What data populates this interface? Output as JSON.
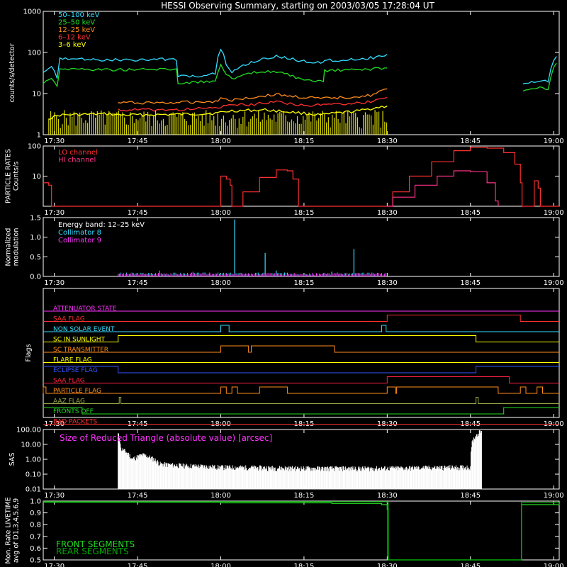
{
  "title": "HESSI Observing Summary, starting on 2003/03/05 17:28:04 UT",
  "time_axis": {
    "ticks": [
      "17:30",
      "17:45",
      "18:00",
      "18:15",
      "18:30",
      "18:45",
      "19:00"
    ],
    "range_minutes": [
      118,
      211
    ],
    "tick_minutes": [
      120,
      135,
      150,
      165,
      180,
      195,
      210
    ]
  },
  "colors": {
    "white": "#ffffff",
    "red": "#ff3030",
    "orange": "#ff8c1a",
    "yellow": "#ffff00",
    "green": "#22dd22",
    "cyan": "#33ddff",
    "magenta": "#ff33ff",
    "blue": "#3355ff",
    "olive": "#99aa44",
    "darkgreen": "#00aa00",
    "crimson": "#ff2244"
  },
  "chart_data": [
    {
      "id": "count-rates",
      "type": "line",
      "ylabel": "counts/s/detector",
      "yscale": "log",
      "ylim": [
        1,
        1000
      ],
      "yticks": [
        "1",
        "10",
        "100",
        "1000"
      ],
      "ytick_values": [
        1,
        10,
        100,
        1000
      ],
      "legend_placement": "top-left",
      "series": [
        {
          "name": "50–100 keV",
          "color": "#33ddff",
          "points": [
            [
              118,
              30
            ],
            [
              119.5,
              45
            ],
            [
              120.5,
              25
            ],
            [
              121,
              70
            ],
            [
              130,
              66
            ],
            [
              142,
              68
            ],
            [
              142.3,
              26
            ],
            [
              146,
              27
            ],
            [
              149,
              30
            ],
            [
              150,
              120
            ],
            [
              151,
              50
            ],
            [
              152,
              32
            ],
            [
              155,
              55
            ],
            [
              160,
              80
            ],
            [
              165,
              60
            ],
            [
              168.5,
              58
            ],
            [
              168.7,
              64
            ],
            [
              173,
              66
            ],
            [
              178,
              75
            ],
            [
              180,
              90
            ]
          ]
        },
        {
          "name": "25–50 keV",
          "color": "#22dd22",
          "points": [
            [
              118,
              18
            ],
            [
              119.5,
              25
            ],
            [
              120.5,
              15
            ],
            [
              121,
              40
            ],
            [
              130,
              38
            ],
            [
              142,
              39
            ],
            [
              142.3,
              18
            ],
            [
              149,
              20
            ],
            [
              150,
              50
            ],
            [
              151,
              30
            ],
            [
              152,
              22
            ],
            [
              156,
              32
            ],
            [
              160,
              35
            ],
            [
              163,
              26
            ],
            [
              165,
              20
            ],
            [
              168.5,
              20
            ],
            [
              168.7,
              36
            ],
            [
              175,
              38
            ],
            [
              180,
              42
            ]
          ]
        },
        {
          "name": "12–25 keV",
          "color": "#ff8c1a",
          "points": [
            [
              131.5,
              6
            ],
            [
              142,
              6
            ],
            [
              149,
              6.5
            ],
            [
              150,
              7.5
            ],
            [
              152,
              7
            ],
            [
              157,
              8.5
            ],
            [
              160,
              9.5
            ],
            [
              163,
              8.5
            ],
            [
              168,
              7.5
            ],
            [
              172,
              8
            ],
            [
              177,
              9
            ],
            [
              180,
              13
            ]
          ]
        },
        {
          "name": "6–12 keV",
          "color": "#ff3030",
          "points": [
            [
              131.5,
              4
            ],
            [
              142,
              4
            ],
            [
              149,
              4.5
            ],
            [
              151,
              5
            ],
            [
              156,
              5.5
            ],
            [
              160,
              6.5
            ],
            [
              165,
              5
            ],
            [
              170,
              5.5
            ],
            [
              176,
              6
            ],
            [
              180,
              8
            ]
          ]
        },
        {
          "name": "3–6 keV",
          "color": "#ffff00",
          "points": [
            [
              119,
              2.5
            ],
            [
              121,
              3
            ],
            [
              130,
              3.2
            ],
            [
              131.5,
              3
            ],
            [
              142,
              3.1
            ],
            [
              149,
              3.3
            ],
            [
              152,
              3.8
            ],
            [
              158,
              4
            ],
            [
              163,
              3.5
            ],
            [
              168,
              3
            ],
            [
              175,
              3.8
            ],
            [
              180,
              5
            ]
          ]
        }
      ],
      "late_segments": [
        {
          "color": "#33ddff",
          "points": [
            [
              204.5,
              18
            ],
            [
              207,
              20
            ],
            [
              209,
              20
            ],
            [
              210.5,
              80
            ]
          ]
        },
        {
          "color": "#22dd22",
          "points": [
            [
              204.5,
              12
            ],
            [
              207,
              14
            ],
            [
              209,
              13
            ],
            [
              210.5,
              55
            ]
          ]
        }
      ]
    },
    {
      "id": "particle-rates",
      "type": "line",
      "ylabel": "PARTICLE RATES Counts/s",
      "yscale": "log",
      "ylim": [
        1,
        100
      ],
      "yticks": [
        "10",
        "100"
      ],
      "ytick_values": [
        10,
        100
      ],
      "legend_placement": "top-left",
      "series": [
        {
          "name": "LO channel",
          "color": "#ff3030",
          "points": [
            [
              118,
              6
            ],
            [
              119,
              5
            ],
            [
              119.5,
              1
            ],
            [
              149.5,
              1
            ],
            [
              150,
              10
            ],
            [
              151,
              8
            ],
            [
              151.7,
              5
            ],
            [
              152,
              1
            ],
            [
              153,
              1
            ],
            [
              154,
              3
            ],
            [
              157,
              9
            ],
            [
              160,
              16
            ],
            [
              162,
              15
            ],
            [
              163,
              8
            ],
            [
              164,
              1
            ],
            [
              180,
              1
            ],
            [
              181,
              3
            ],
            [
              184,
              10
            ],
            [
              188,
              30
            ],
            [
              192,
              70
            ],
            [
              195,
              90
            ],
            [
              198,
              85
            ],
            [
              201,
              60
            ],
            [
              203,
              25
            ],
            [
              204,
              6
            ],
            [
              204.3,
              1
            ],
            [
              206,
              1
            ],
            [
              206.5,
              7
            ],
            [
              207.2,
              4
            ],
            [
              207.6,
              1
            ],
            [
              211,
              1
            ]
          ]
        },
        {
          "name": "HI channel",
          "color": "#ff3388",
          "points": [
            [
              180,
              1
            ],
            [
              181,
              2
            ],
            [
              185,
              5
            ],
            [
              189,
              10
            ],
            [
              192,
              15
            ],
            [
              195,
              14
            ],
            [
              198,
              6
            ],
            [
              199.5,
              1.5
            ],
            [
              200,
              1
            ]
          ]
        }
      ]
    },
    {
      "id": "modulation",
      "type": "line",
      "ylabel": "Normalized modulation",
      "ylim": [
        0,
        1.5
      ],
      "yticks": [
        "0.0",
        "0.5",
        "1.0",
        "1.5"
      ],
      "ytick_values": [
        0,
        0.5,
        1.0,
        1.5
      ],
      "annotations": [
        "Energy band: 12–25 keV"
      ],
      "series": [
        {
          "name": "Collimator 8",
          "color": "#33ddff",
          "baseline": 0.04,
          "range": [
            131.5,
            180
          ],
          "spikes": [
            [
              152.5,
              1.45
            ],
            [
              158,
              0.6
            ],
            [
              160,
              0.15
            ],
            [
              174,
              0.7
            ],
            [
              170,
              0.12
            ]
          ]
        },
        {
          "name": "Collimator 9",
          "color": "#ff33ff",
          "baseline": 0.03,
          "range": [
            131.5,
            180
          ],
          "spikes": [
            [
              139,
              0.15
            ],
            [
              145,
              0.12
            ],
            [
              148,
              0.1
            ]
          ]
        }
      ]
    },
    {
      "id": "flags",
      "type": "line",
      "ylabel": "Flags",
      "rows": [
        {
          "name": "ATTENUATOR STATE",
          "color": "#ff33ff",
          "on": []
        },
        {
          "name": "SAA FLAG",
          "color": "#ff3030",
          "on": [
            [
              180,
              204
            ]
          ]
        },
        {
          "name": "NON SOLAR EVENT",
          "color": "#33ddff",
          "on": [
            [
              150,
              151.5
            ],
            [
              179,
              179.8
            ]
          ]
        },
        {
          "name": "SC IN SUNLIGHT",
          "color": "#ffff00",
          "on": [
            [
              131.5,
              196
            ]
          ]
        },
        {
          "name": "SC TRANSMITTER",
          "color": "#ff8c1a",
          "on": [
            [
              150,
              155
            ],
            [
              155.5,
              170.5
            ]
          ]
        },
        {
          "name": "FLARE FLAG",
          "color": "#ffff00",
          "on": []
        },
        {
          "name": "ECLIPSE FLAG",
          "color": "#3355ff",
          "on_state": "low",
          "on": [
            [
              131.5,
              196
            ]
          ]
        },
        {
          "name": "SAA FLAG",
          "color": "#ff2244",
          "on": [
            [
              180,
              202
            ]
          ]
        },
        {
          "name": "PARTICLE FLAG",
          "color": "#ff8c1a",
          "on": [
            [
              118,
              118.5
            ],
            [
              150,
              151
            ],
            [
              152,
              153
            ],
            [
              157,
              162
            ],
            [
              180,
              181.5
            ],
            [
              181.7,
              200
            ],
            [
              204,
              205
            ],
            [
              207,
              208
            ]
          ]
        },
        {
          "name": "AAZ FLAG",
          "color": "#99aa44",
          "on": [
            [
              131.7,
              132
            ],
            [
              196,
              196.4
            ]
          ]
        },
        {
          "name": "FRONTS OFF",
          "color": "#22dd22",
          "on_state": "low",
          "on": [
            [
              125,
              201
            ]
          ]
        },
        {
          "name": "BAD PACKETS",
          "color": "#ff3030",
          "on": []
        }
      ]
    },
    {
      "id": "sas",
      "type": "area",
      "ylabel": "SAS",
      "yscale": "log",
      "ylim": [
        0.01,
        100
      ],
      "yticks": [
        "0.01",
        "0.10",
        "1.00",
        "10.00",
        "100.00"
      ],
      "ytick_values": [
        0.01,
        0.1,
        1,
        10,
        100
      ],
      "annotations": [
        "Size of Reduced Triangle (absolute value) [arcsec]"
      ],
      "series": [
        {
          "name": "Size of Reduced Triangle",
          "color": "#ffffff",
          "range": [
            131.5,
            197
          ],
          "levels": [
            [
              131.5,
              50
            ],
            [
              132,
              5
            ],
            [
              134,
              1
            ],
            [
              136,
              2
            ],
            [
              138,
              1
            ],
            [
              139,
              0.5
            ],
            [
              142,
              0.4
            ],
            [
              150,
              0.3
            ],
            [
              165,
              0.25
            ],
            [
              180,
              0.25
            ],
            [
              195,
              0.3
            ],
            [
              197,
              80
            ]
          ]
        }
      ]
    },
    {
      "id": "livetime",
      "type": "line",
      "ylabel": "Mon. Rate LIVETIME avg of D1,3,4,5,6,9",
      "ylim": [
        0.5,
        1.0
      ],
      "yticks": [
        "0.5",
        "0.6",
        "0.7",
        "0.8",
        "0.9",
        "1.0"
      ],
      "ytick_values": [
        0.5,
        0.6,
        0.7,
        0.8,
        0.9,
        1.0
      ],
      "legend_placement": "bottom-left",
      "series": [
        {
          "name": "FRONT SEGMENTS",
          "color": "#22dd22",
          "points": [
            [
              118,
              0.99
            ],
            [
              150,
              0.985
            ],
            [
              170,
              0.98
            ],
            [
              179,
              0.97
            ],
            [
              180,
              0.93
            ],
            [
              180.1,
              0.5
            ],
            [
              204,
              0.5
            ],
            [
              204.2,
              0.97
            ],
            [
              211,
              0.98
            ]
          ]
        },
        {
          "name": "REAR SEGMENTS",
          "color": "#00aa00",
          "points": [
            [
              118,
              0.995
            ],
            [
              180,
              0.99
            ],
            [
              180.2,
              0.5
            ],
            [
              204,
              0.5
            ],
            [
              204.2,
              0.99
            ],
            [
              211,
              0.99
            ]
          ]
        }
      ]
    }
  ]
}
